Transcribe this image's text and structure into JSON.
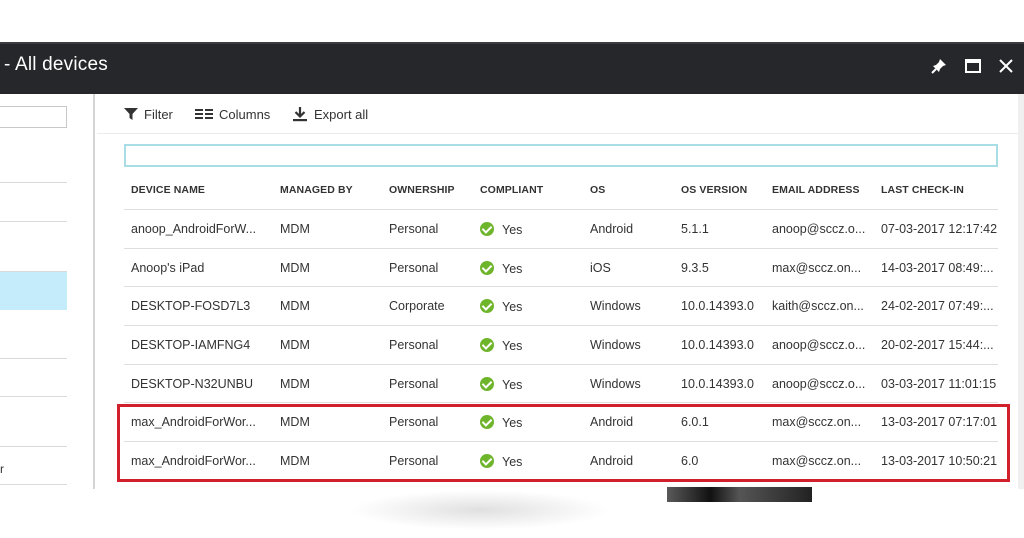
{
  "window": {
    "title": "- All devices",
    "controls": {
      "pin": "pin-icon",
      "maximize": "maximize-icon",
      "close": "close-icon"
    }
  },
  "left_pane": {
    "search_placeholder": "",
    "partial_item_text": "r"
  },
  "toolbar": {
    "filter_label": "Filter",
    "columns_label": "Columns",
    "export_label": "Export all"
  },
  "filter_input": {
    "value": "",
    "placeholder": ""
  },
  "table": {
    "columns": [
      "DEVICE NAME",
      "MANAGED BY",
      "OWNERSHIP",
      "COMPLIANT",
      "OS",
      "OS VERSION",
      "EMAIL ADDRESS",
      "LAST CHECK-IN"
    ],
    "rows": [
      {
        "device": "anoop_AndroidForW...",
        "managed_by": "MDM",
        "ownership": "Personal",
        "compliant": "Yes",
        "os": "Android",
        "os_version": "5.1.1",
        "email": "anoop@sccz.o...",
        "last_checkin": "07-03-2017 12:17:42"
      },
      {
        "device": "Anoop's iPad",
        "managed_by": "MDM",
        "ownership": "Personal",
        "compliant": "Yes",
        "os": "iOS",
        "os_version": "9.3.5",
        "email": "max@sccz.on...",
        "last_checkin": "14-03-2017 08:49:..."
      },
      {
        "device": "DESKTOP-FOSD7L3",
        "managed_by": "MDM",
        "ownership": "Corporate",
        "compliant": "Yes",
        "os": "Windows",
        "os_version": "10.0.14393.0",
        "email": "kaith@sccz.on...",
        "last_checkin": "24-02-2017 07:49:..."
      },
      {
        "device": "DESKTOP-IAMFNG4",
        "managed_by": "MDM",
        "ownership": "Personal",
        "compliant": "Yes",
        "os": "Windows",
        "os_version": "10.0.14393.0",
        "email": "anoop@sccz.o...",
        "last_checkin": "20-02-2017 15:44:..."
      },
      {
        "device": "DESKTOP-N32UNBU",
        "managed_by": "MDM",
        "ownership": "Personal",
        "compliant": "Yes",
        "os": "Windows",
        "os_version": "10.0.14393.0",
        "email": "anoop@sccz.o...",
        "last_checkin": "03-03-2017 11:01:15"
      },
      {
        "device": "max_AndroidForWor...",
        "managed_by": "MDM",
        "ownership": "Personal",
        "compliant": "Yes",
        "os": "Android",
        "os_version": "6.0.1",
        "email": "max@sccz.on...",
        "last_checkin": "13-03-2017 07:17:01"
      },
      {
        "device": "max_AndroidForWor...",
        "managed_by": "MDM",
        "ownership": "Personal",
        "compliant": "Yes",
        "os": "Android",
        "os_version": "6.0",
        "email": "max@sccz.on...",
        "last_checkin": "13-03-2017 10:50:21"
      }
    ],
    "highlighted_rows": [
      5,
      6
    ]
  },
  "colors": {
    "titlebar_bg": "#25272b",
    "compliant_green": "#6fb52c",
    "highlight_red": "#d21f2c",
    "selected_nav_bg": "#c4ecfb",
    "filter_border": "#a8dde5"
  }
}
